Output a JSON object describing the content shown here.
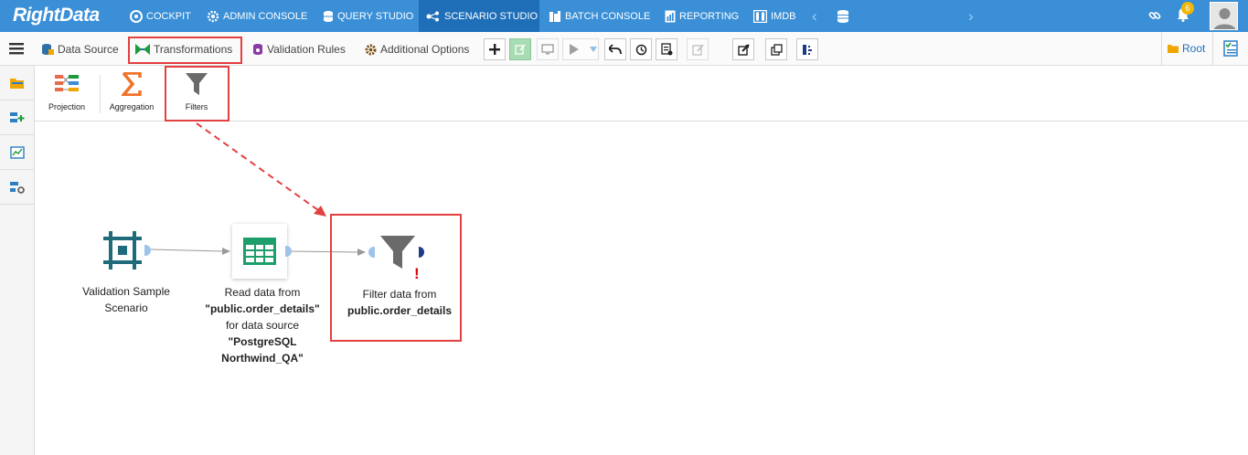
{
  "app": {
    "logo": "RightData"
  },
  "nav": {
    "items": [
      {
        "label": "COCKPIT",
        "icon": "cockpit-icon"
      },
      {
        "label": "ADMIN CONSOLE",
        "icon": "gear-icon"
      },
      {
        "label": "QUERY STUDIO",
        "icon": "database-icon"
      },
      {
        "label": "SCENARIO STUDIO",
        "icon": "scenario-icon",
        "active": true
      },
      {
        "label": "BATCH CONSOLE",
        "icon": "batch-icon"
      },
      {
        "label": "REPORTING",
        "icon": "report-icon"
      },
      {
        "label": "IMDB",
        "icon": "imdb-icon"
      }
    ],
    "notification_count": "6"
  },
  "toolbar": {
    "tabs": [
      {
        "label": "Data Source",
        "icon": "datasource-icon"
      },
      {
        "label": "Transformations",
        "icon": "transformations-icon",
        "highlighted": true
      },
      {
        "label": "Validation Rules",
        "icon": "validation-icon"
      },
      {
        "label": "Additional Options",
        "icon": "options-gear-icon"
      }
    ],
    "root_label": "Root"
  },
  "palette": {
    "items": [
      {
        "label": "Projection",
        "icon": "projection-icon"
      },
      {
        "label": "Aggregation",
        "icon": "sigma-icon"
      },
      {
        "label": "Filters",
        "icon": "filter-icon",
        "highlighted": true
      }
    ]
  },
  "canvas": {
    "nodes": {
      "scenario": {
        "line1": "Validation Sample",
        "line2": "Scenario"
      },
      "read": {
        "line1": "Read data from",
        "line2": "\"public.order_details\"",
        "line3": "for data source",
        "line4": "\"PostgreSQL",
        "line5": "Northwind_QA\""
      },
      "filter": {
        "line1": "Filter data from",
        "line2": "public.order_details",
        "warning": "!"
      }
    }
  },
  "colors": {
    "navbar": "#3a8fd6",
    "nav_active": "#1f6fb8",
    "highlight": "#e34040",
    "node_teal": "#1f6b7a",
    "grid_green": "#1e9e6a"
  }
}
